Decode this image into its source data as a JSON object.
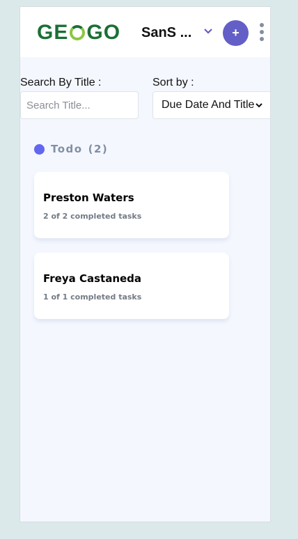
{
  "header": {
    "logo_text_left": "GE",
    "logo_text_right": "GO",
    "logo_alt": "GEOGO",
    "board_title": "SanS ...",
    "add_label": "+",
    "accent": "#635fc7"
  },
  "filters": {
    "search_label": "Search By Title :",
    "search_placeholder": "Search Title...",
    "search_value": "",
    "sort_label": "Sort by :",
    "sort_value": "Due Date And Title"
  },
  "columns": [
    {
      "name": "Todo",
      "count_text": "(2)",
      "dot_color": "#6366f1",
      "cards": [
        {
          "title": "Preston Waters",
          "subtitle": "2 of 2 completed tasks"
        },
        {
          "title": "Freya Castaneda",
          "subtitle": "1 of 1 completed tasks"
        }
      ]
    }
  ]
}
